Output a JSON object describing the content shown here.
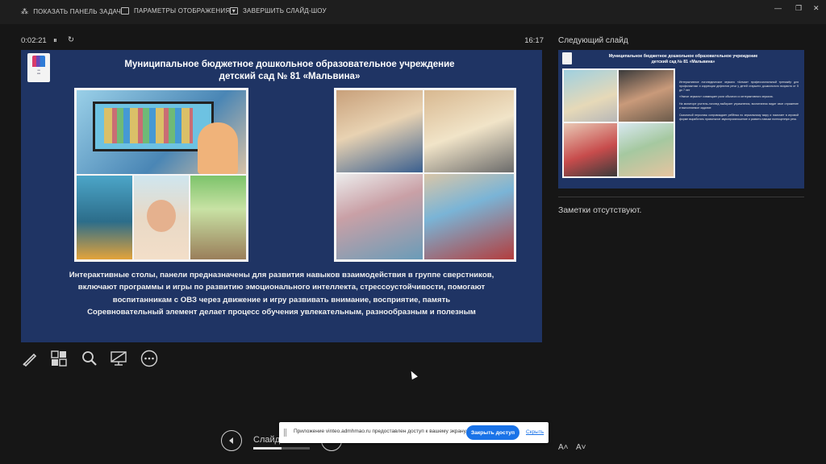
{
  "toolbar": {
    "show_taskbar": "ПОКАЗАТЬ ПАНЕЛЬ ЗАДАЧ",
    "display_settings": "ПАРАМЕТРЫ ОТОБРАЖЕНИЯ ▾",
    "end_show": "ЗАВЕРШИТЬ СЛАЙД-ШОУ"
  },
  "window": {
    "minimize": "—",
    "restore": "❐",
    "close": "✕"
  },
  "presenter": {
    "timer": "0:02:21",
    "pause": "⏸",
    "reset": "↻",
    "clock": "16:17"
  },
  "slide": {
    "title_line1": "Муниципальное бюджетное дошкольное образовательное учреждение",
    "title_line2": "детский сад № 81 «Мальвина»",
    "body_line1": "Интерактивные столы, панели предназначены для развития навыков взаимодействия в группе сверстников,",
    "body_line2": "включают программы и игры по развитию эмоционального интеллекта, стрессоустойчивости, помогают",
    "body_line3": "воспитанникам с ОВЗ через движение и игру развивать внимание, восприятие, память",
    "body_line4": "Соревновательный элемент делает процесс обучения увлекательным, разнообразным и полезным"
  },
  "next": {
    "label": "Следующий слайд",
    "title_line1": "Муниципальное бюджетное дошкольное образовательное учреждение",
    "title_line2": "детский сад № 81 «Мальвина»",
    "para1": "Интерактивное логопедическое зеркало «Алмаз» профессиональный тренажёр для профилактики и коррекции дефектов речи у детей старшего дошкольного возраста от 5 до 7 лет",
    "para2": "«Умное зеркало» совмещает роли обычного и интерактивного зеркала.",
    "para3": "На мониторе учитель-логопед выбирает упражнения, воспитанник видит свое отражение и выполняемое задание",
    "para4": "Сказочный персонаж сопровождает ребёнка по зеркальному миру и помогает в игровой форме выработать правильное звукопроизношение и развить навыки полноценную речь"
  },
  "notes": {
    "text": "Заметки отсутствуют."
  },
  "nav": {
    "counter_label": "Слайд",
    "progress": 0.5,
    "font_increase": "A˄",
    "font_decrease": "A˅"
  },
  "share": {
    "text": "Приложение vinteo.admhmao.ru предоставлен доступ к вашему экрану.",
    "stop_button": "Закрыть доступ",
    "hide_link": "Скрыть"
  },
  "colors": {
    "slide_bg": "#1f3464",
    "app_bg": "#161616",
    "accent": "#1a73e8"
  }
}
